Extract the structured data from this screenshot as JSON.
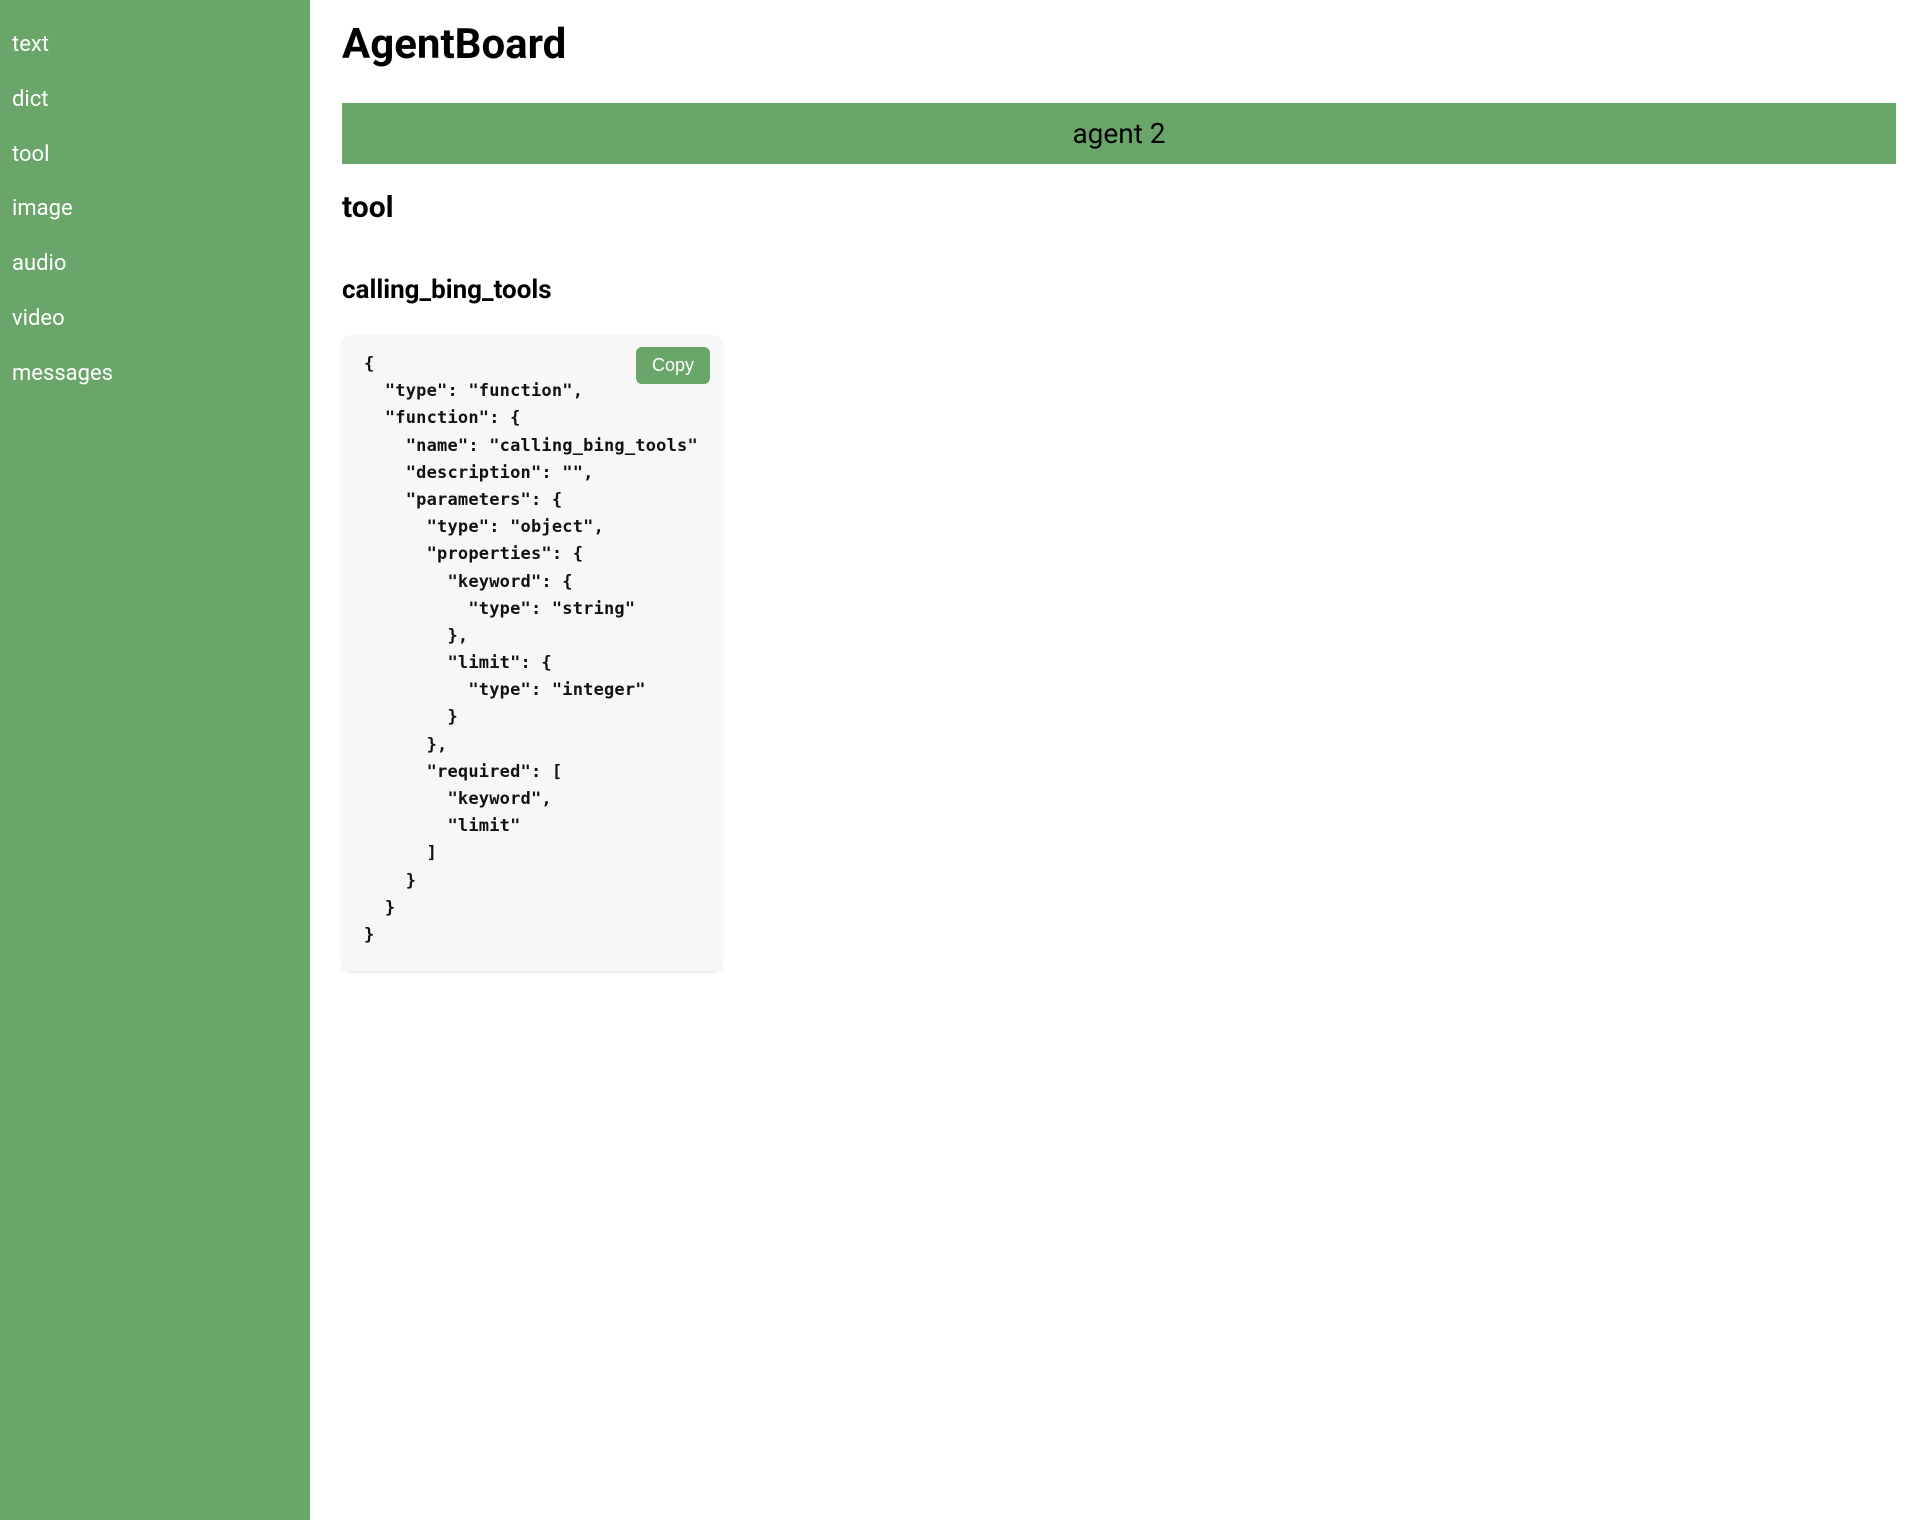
{
  "sidebar": {
    "items": [
      {
        "label": "text"
      },
      {
        "label": "dict"
      },
      {
        "label": "tool"
      },
      {
        "label": "image"
      },
      {
        "label": "audio"
      },
      {
        "label": "video"
      },
      {
        "label": "messages"
      }
    ]
  },
  "header": {
    "title": "AgentBoard"
  },
  "main": {
    "agent_label": "agent 2",
    "section_title": "tool",
    "section_subtitle": "calling_bing_tools",
    "copy_label": "Copy",
    "code": "{\n  \"type\": \"function\",\n  \"function\": {\n    \"name\": \"calling_bing_tools\"\n    \"description\": \"\",\n    \"parameters\": {\n      \"type\": \"object\",\n      \"properties\": {\n        \"keyword\": {\n          \"type\": \"string\"\n        },\n        \"limit\": {\n          \"type\": \"integer\"\n        }\n      },\n      \"required\": [\n        \"keyword\",\n        \"limit\"\n      ]\n    }\n  }\n}"
  }
}
